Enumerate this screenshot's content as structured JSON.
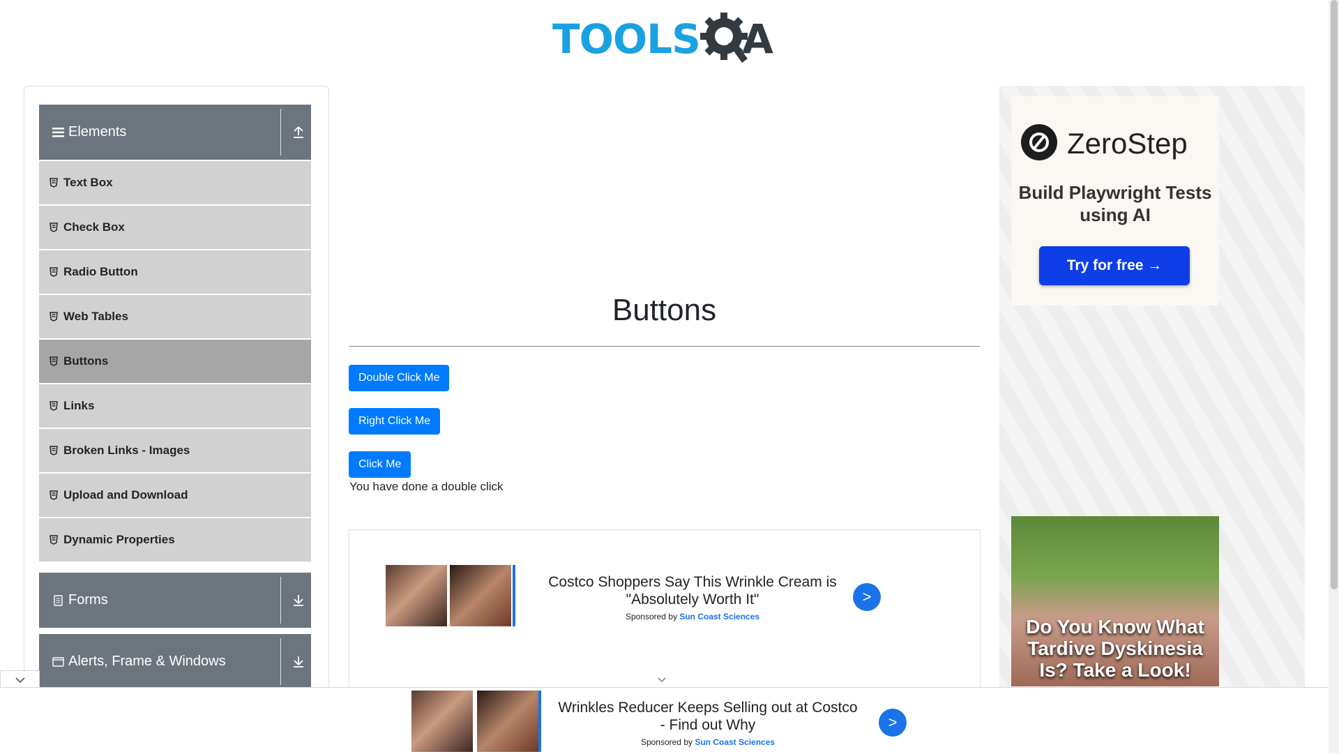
{
  "header": {
    "logo_tools": "TOOLS",
    "logo_a": "A",
    "logo_q": "Q"
  },
  "sidebar": {
    "elements_header": "Elements",
    "items": [
      {
        "label": "Text Box"
      },
      {
        "label": "Check Box"
      },
      {
        "label": "Radio Button"
      },
      {
        "label": "Web Tables"
      },
      {
        "label": "Buttons",
        "active": true
      },
      {
        "label": "Links"
      },
      {
        "label": "Broken Links - Images"
      },
      {
        "label": "Upload and Download"
      },
      {
        "label": "Dynamic Properties"
      }
    ],
    "forms_header": "Forms",
    "alerts_header": "Alerts, Frame & Windows"
  },
  "main": {
    "title": "Buttons",
    "double_click_label": "Double Click Me",
    "right_click_label": "Right Click Me",
    "click_label": "Click Me",
    "message": "You have done a double click"
  },
  "ad_card": {
    "headline": "Costco Shoppers Say This Wrinkle Cream is \"Absolutely Worth It\"",
    "sponsor_prefix": "Sponsored by",
    "sponsor": "Sun Coast Sciences",
    "go": ">"
  },
  "right_ads": {
    "zerostep_name": "ZeroStep",
    "zerostep_tagline": "Build Playwright Tests using AI",
    "zerostep_cta": "Try for free →",
    "td_text": "Do You Know What Tardive Dyskinesia Is? Take a Look!"
  },
  "sticky_ad": {
    "headline": "Wrinkles Reducer Keeps Selling out at Costco - Find out Why",
    "sponsor_prefix": "Sponsored by",
    "sponsor": "Sun Coast Sciences",
    "go": ">"
  },
  "colors": {
    "primary": "#007bff",
    "sidebar_header": "#6c757d",
    "sidebar_item": "#d1d1d1",
    "sidebar_active": "#a6a6a6",
    "ad_blue": "#1a73e8"
  }
}
